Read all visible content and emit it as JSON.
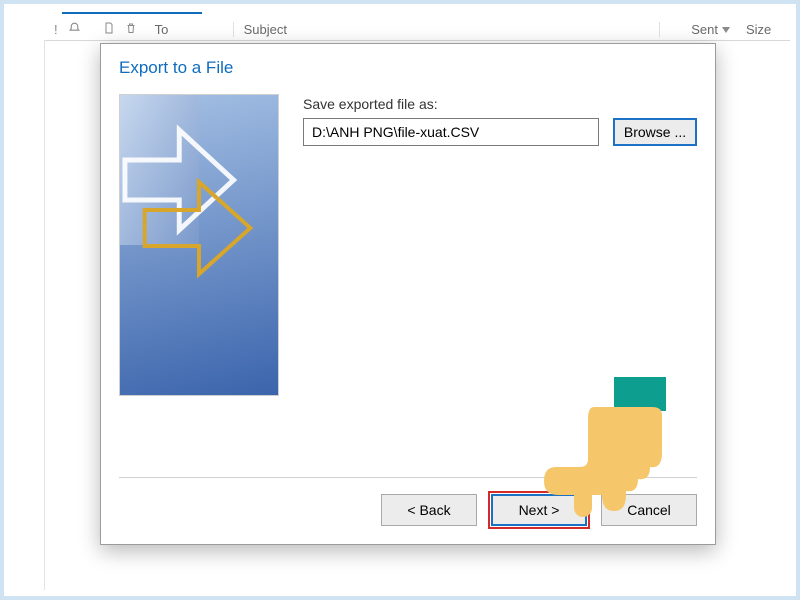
{
  "bg": {
    "col_to": "To",
    "col_subject": "Subject",
    "col_sent": "Sent",
    "col_size": "Size"
  },
  "dialog": {
    "title": "Export to a File",
    "save_label": "Save exported file as:",
    "path_value": "D:\\ANH PNG\\file-xuat.CSV",
    "browse": "Browse ...",
    "back": "<  Back",
    "next": "Next  >",
    "cancel": "Cancel"
  }
}
